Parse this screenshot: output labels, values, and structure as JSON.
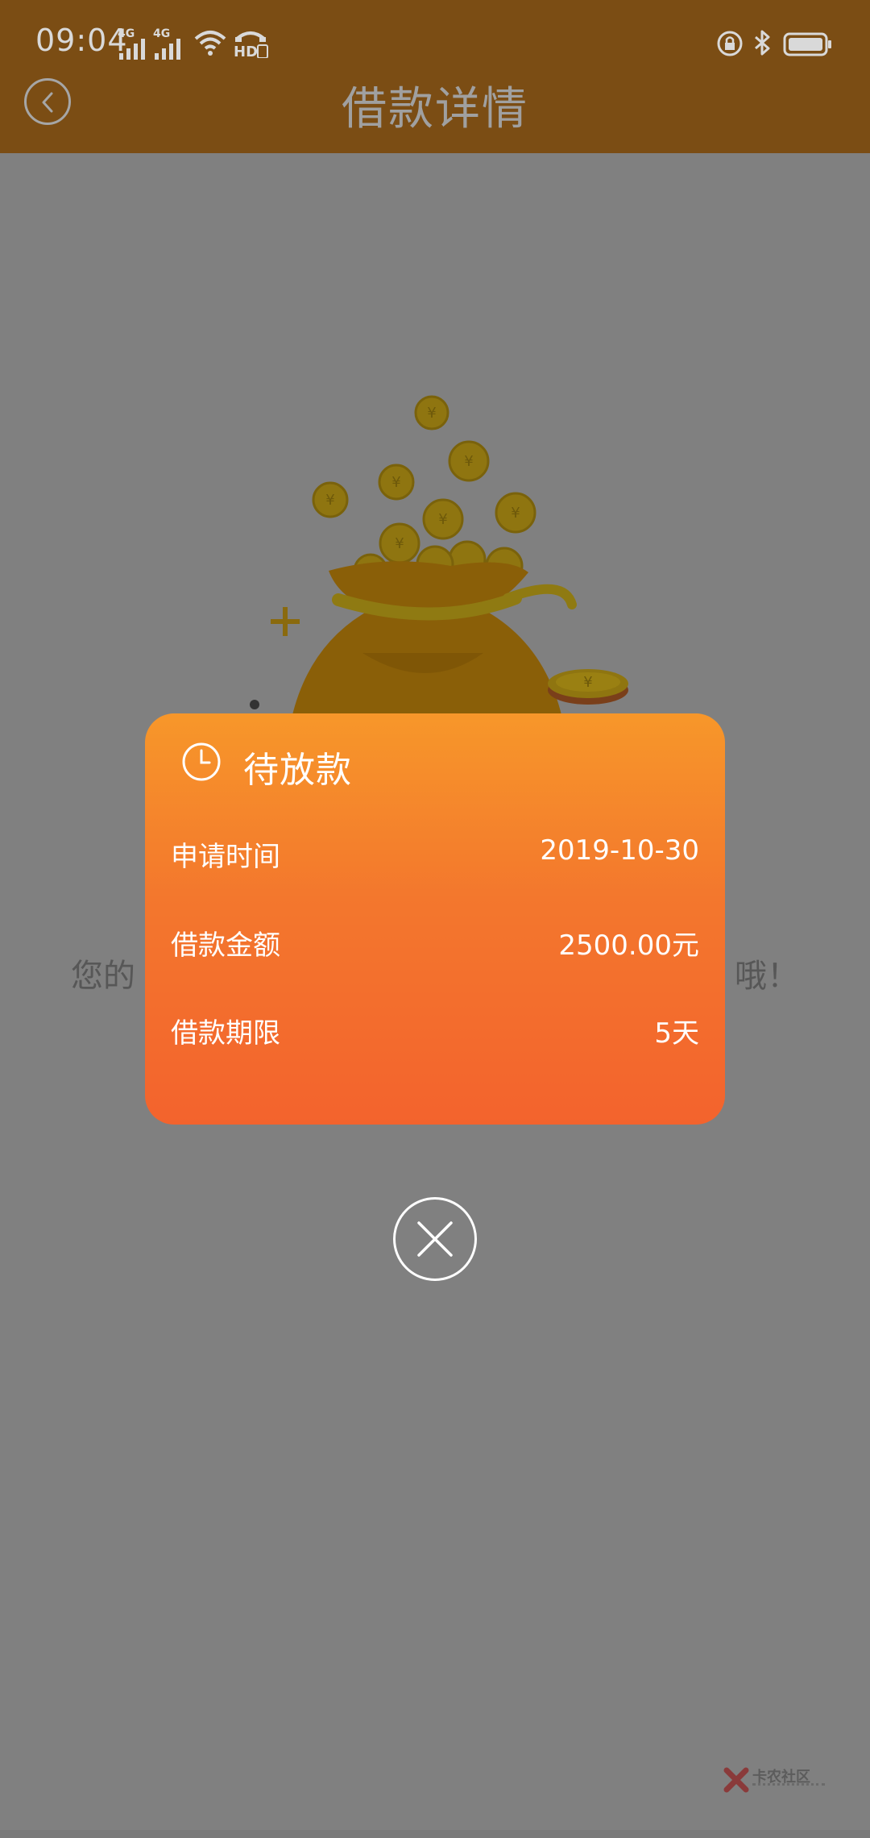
{
  "status_bar": {
    "time": "09:04",
    "signal1_tag": "4G",
    "signal2_tag": "4G"
  },
  "header": {
    "title": "借款详情"
  },
  "background": {
    "message_start": "您的",
    "message_end": "哦！"
  },
  "modal": {
    "title": "待放款",
    "rows": [
      {
        "label": "申请时间",
        "value": "2019-10-30"
      },
      {
        "label": "借款金额",
        "value": "2500.00元"
      },
      {
        "label": "借款期限",
        "value": "5天"
      }
    ]
  },
  "watermark": {
    "text": "卡农社区"
  },
  "colors": {
    "header_bg": "#7b4d14",
    "overlay_bg": "#808080",
    "modal_gradient_top": "#f7972a",
    "modal_gradient_bottom": "#f3632d",
    "text_on_modal": "#ffffff"
  }
}
